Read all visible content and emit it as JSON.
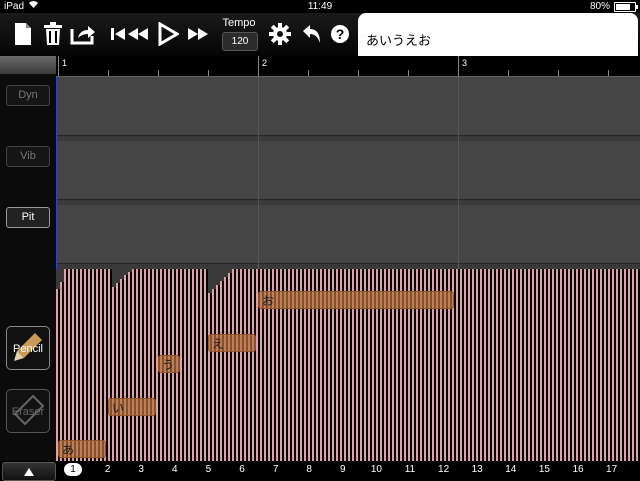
{
  "status": {
    "device": "iPad",
    "time": "11:49",
    "battery": "80%",
    "battery_level": 0.8
  },
  "toolbar": {
    "tempo_label": "Tempo",
    "tempo_value": "120",
    "lyric_value": "あいうえお"
  },
  "sidebar": {
    "params": [
      "Dyn",
      "Vib",
      "Pit"
    ],
    "tools": [
      "Pencil",
      "Eraser"
    ]
  },
  "ruler": {
    "bars": [
      "1",
      "2",
      "3"
    ]
  },
  "notes": [
    {
      "lyric": "あ"
    },
    {
      "lyric": "い"
    },
    {
      "lyric": "う"
    },
    {
      "lyric": "え"
    },
    {
      "lyric": "お"
    }
  ],
  "pages": [
    "1",
    "2",
    "3",
    "4",
    "5",
    "6",
    "7",
    "8",
    "9",
    "10",
    "11",
    "12",
    "13",
    "14",
    "15",
    "16",
    "17"
  ],
  "colors": {
    "key": "#e0a0a4",
    "note": "#b5703c",
    "lyric_bg": "#ffffff",
    "cursor": "#3344cc"
  }
}
